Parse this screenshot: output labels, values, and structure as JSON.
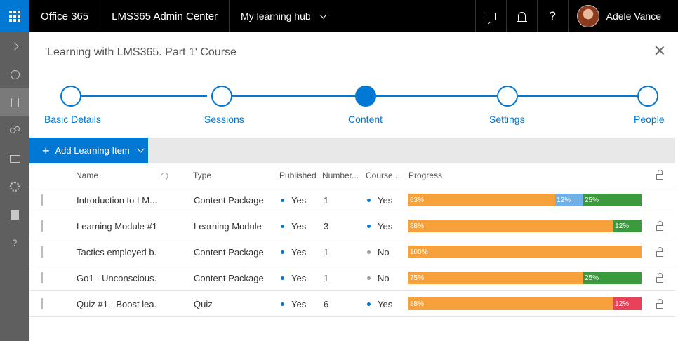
{
  "topbar": {
    "brand": "Office 365",
    "app_name": "LMS365 Admin Center",
    "hub_label": "My learning hub",
    "user_name": "Adele Vance"
  },
  "panel": {
    "title": "'Learning with LMS365. Part 1' Course"
  },
  "stepper": {
    "steps": [
      {
        "label": "Basic Details",
        "state": "complete"
      },
      {
        "label": "Sessions",
        "state": "complete"
      },
      {
        "label": "Content",
        "state": "current"
      },
      {
        "label": "Settings",
        "state": "upcoming"
      },
      {
        "label": "People",
        "state": "upcoming"
      }
    ]
  },
  "toolbar": {
    "add_label": "Add Learning Item"
  },
  "table": {
    "columns": {
      "name": "Name",
      "type": "Type",
      "published": "Published",
      "number": "Number...",
      "course": "Course ...",
      "progress": "Progress"
    },
    "rows": [
      {
        "name": "Introduction to LM...",
        "type": "Content Package",
        "published": "Yes",
        "number": "1",
        "course": "Yes",
        "locked": false,
        "progress": [
          {
            "label": "63%",
            "value": 63,
            "color": "orange"
          },
          {
            "label": "12%",
            "value": 12,
            "color": "blue"
          },
          {
            "label": "25%",
            "value": 25,
            "color": "green"
          }
        ]
      },
      {
        "name": "Learning Module #1",
        "type": "Learning Module",
        "published": "Yes",
        "number": "3",
        "course": "Yes",
        "locked": true,
        "progress": [
          {
            "label": "88%",
            "value": 88,
            "color": "orange"
          },
          {
            "label": "12%",
            "value": 12,
            "color": "green"
          }
        ]
      },
      {
        "name": "Tactics employed b...",
        "type": "Content Package",
        "published": "Yes",
        "number": "1",
        "course": "No",
        "locked": true,
        "progress": [
          {
            "label": "100%",
            "value": 100,
            "color": "orange"
          }
        ]
      },
      {
        "name": "Go1 - Unconscious...",
        "type": "Content Package",
        "published": "Yes",
        "number": "1",
        "course": "No",
        "locked": true,
        "progress": [
          {
            "label": "75%",
            "value": 75,
            "color": "orange"
          },
          {
            "label": "25%",
            "value": 25,
            "color": "green"
          }
        ]
      },
      {
        "name": "Quiz #1 - Boost lea...",
        "type": "Quiz",
        "published": "Yes",
        "number": "6",
        "course": "Yes",
        "locked": true,
        "progress": [
          {
            "label": "88%",
            "value": 88,
            "color": "orange"
          },
          {
            "label": "12%",
            "value": 12,
            "color": "red"
          }
        ]
      }
    ]
  },
  "colors": {
    "accent": "#0078d4",
    "orange": "#f7a13c",
    "blue": "#6fb1e6",
    "green": "#3b9a3c",
    "red": "#e8415a"
  }
}
